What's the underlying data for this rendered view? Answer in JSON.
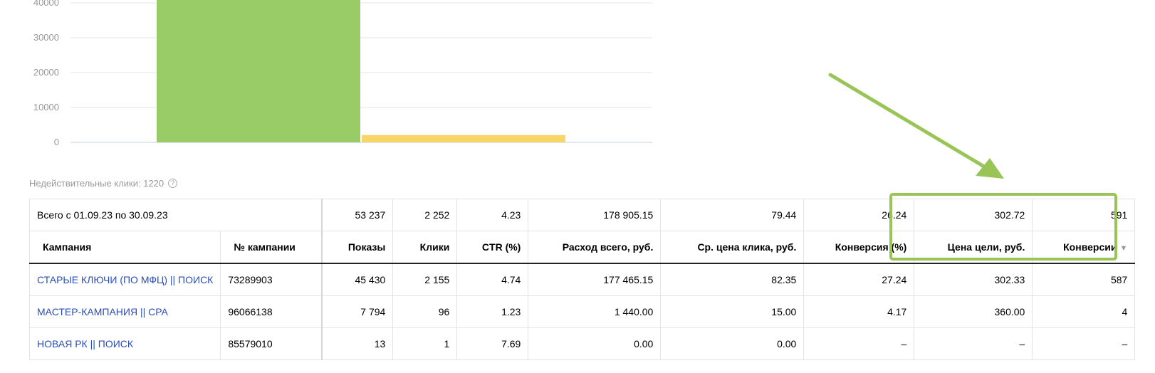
{
  "chart_data": {
    "type": "bar",
    "categories": [
      "",
      ""
    ],
    "values": [
      46000,
      2100
    ],
    "colors": [
      "#99cc66",
      "#f8d568"
    ],
    "ylim": [
      0,
      45000
    ],
    "y_ticks": [
      "0",
      "10000",
      "20000",
      "30000",
      "40000"
    ],
    "grid": true
  },
  "invalid_clicks": {
    "label": "Недействительные клики: 1220",
    "help": "?"
  },
  "table": {
    "total_row": {
      "label": "Всего с 01.09.23 по 30.09.23",
      "values": [
        "53 237",
        "2 252",
        "4.23",
        "178 905.15",
        "79.44",
        "26.24",
        "302.72",
        "591"
      ]
    },
    "headers": [
      "Кампания",
      "№ кампании",
      "Показы",
      "Клики",
      "CTR (%)",
      "Расход всего, руб.",
      "Ср. цена клика, руб.",
      "Конверсия (%)",
      "Цена цели, руб.",
      "Конверсии"
    ],
    "sort_indicator": "▼",
    "rows": [
      {
        "name": "СТАРЫЕ КЛЮЧИ (ПО МФЦ) || ПОИСК",
        "id": "73289903",
        "values": [
          "45 430",
          "2 155",
          "4.74",
          "177 465.15",
          "82.35",
          "27.24",
          "302.33",
          "587"
        ]
      },
      {
        "name": "МАСТЕР-КАМПАНИЯ || CPA",
        "id": "96066138",
        "values": [
          "7 794",
          "96",
          "1.23",
          "1 440.00",
          "15.00",
          "4.17",
          "360.00",
          "4"
        ]
      },
      {
        "name": "НОВАЯ РК || ПОИСК",
        "id": "85579010",
        "values": [
          "13",
          "1",
          "7.69",
          "0.00",
          "0.00",
          "–",
          "–",
          "–"
        ]
      }
    ]
  },
  "highlight": {
    "color": "#99c557"
  }
}
